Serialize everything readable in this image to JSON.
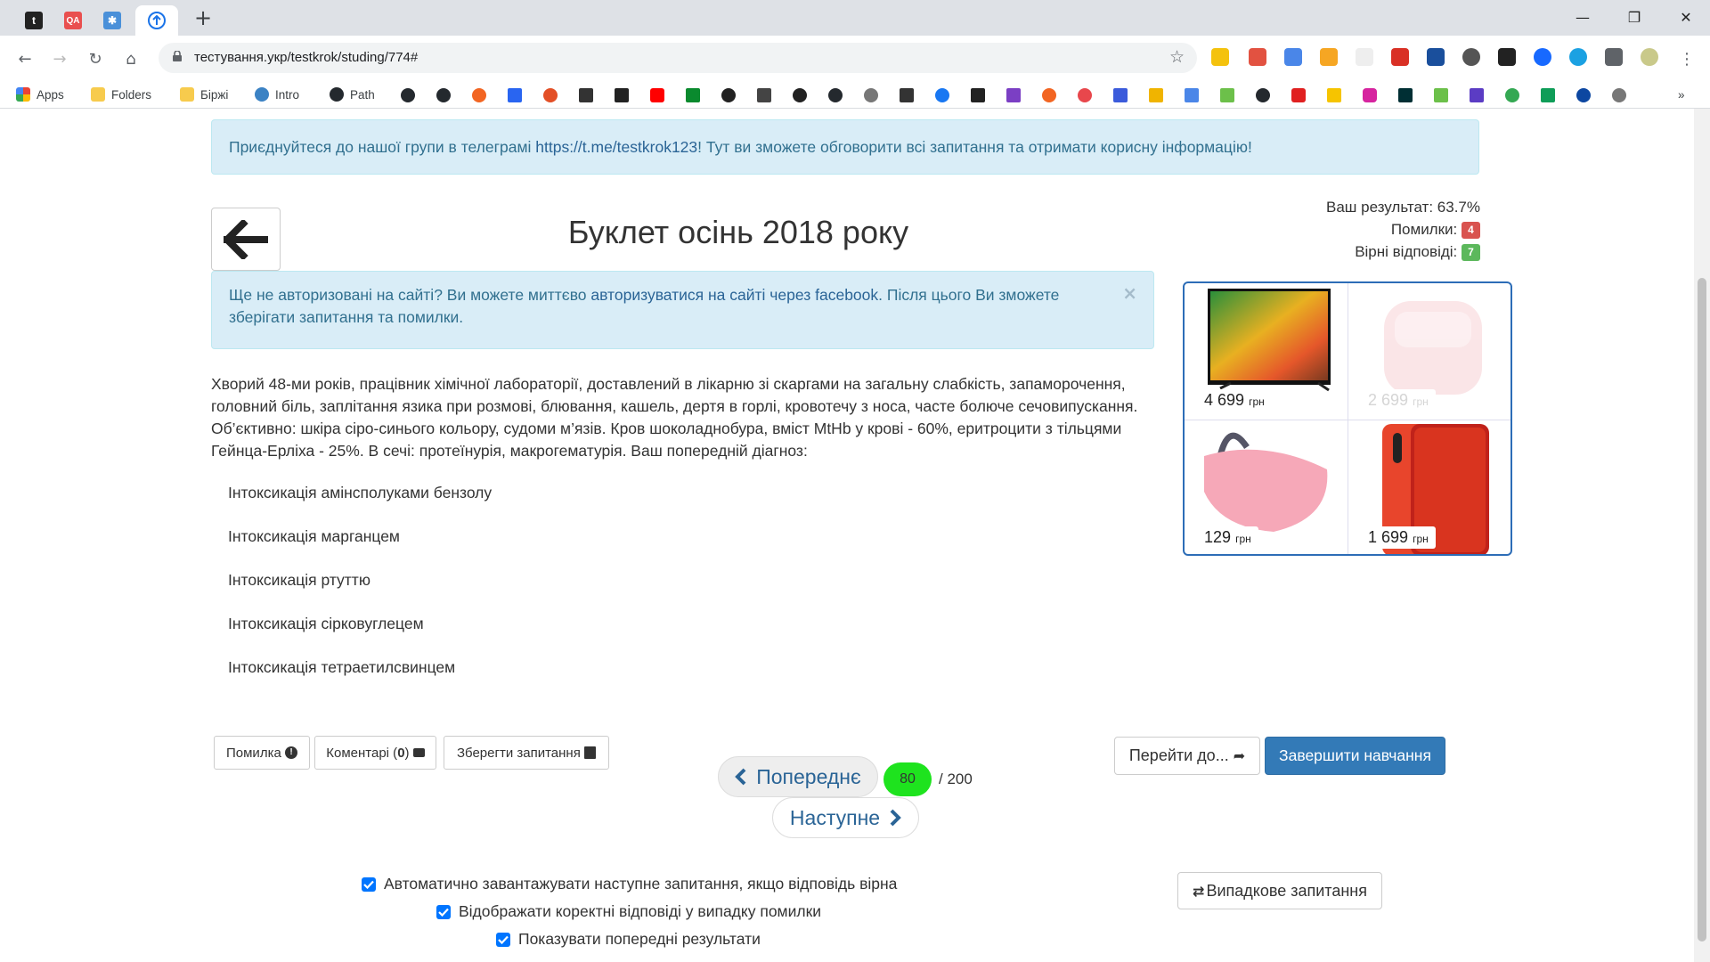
{
  "browser": {
    "url": "тестування.укр/testkrok/studing/774#",
    "tabs": [
      {
        "label": "t",
        "color": "#222222",
        "icon": "tumblr-icon"
      },
      {
        "label": "QA",
        "color": "#e94f4f",
        "icon": "qa-icon"
      },
      {
        "label": "",
        "color": "#4a90d9",
        "icon": "puzzle-icon"
      }
    ],
    "bookmarks": [
      {
        "label": "Apps",
        "color": "#4285f4"
      },
      {
        "label": "Folders",
        "color": "#f7cb4d"
      },
      {
        "label": "Біржі",
        "color": "#f7cb4d"
      },
      {
        "label": "Intro",
        "color": "#3b82c4"
      },
      {
        "label": "Path",
        "color": "#24292e"
      }
    ],
    "more_label": "»"
  },
  "telegram_alert": {
    "text_before": "Приєднуйтеся до нашої групи в телеграмі ",
    "link": "https://t.me/testkrok123",
    "text_after": "! Тут ви зможете обговорити всі запитання та отримати корисну інформацію!"
  },
  "header": {
    "title": "Буклет осінь 2018 року",
    "result_label": "Ваш результат: 63.7%",
    "errors_label": "Помилки:",
    "errors_count": "4",
    "correct_label": "Вірні відповіді:",
    "correct_count": "7",
    "colors": {
      "errors": "#d9534f",
      "correct": "#5cb85c"
    }
  },
  "auth_alert": {
    "text_before": "Ще не авторизовані на сайті? Ви можете миттєво ",
    "link": "авторизуватися на сайті через facebook",
    "text_after": ". Після цього Ви зможете зберігати запитання та помилки.",
    "close": "×"
  },
  "question": {
    "text": "Хворий 48-ми років, працівник хімічної лабораторії, доставлений в лікарню зі скаргами на загальну слабкість, запаморочення, головний біль, заплітання язика при розмові, блювання, кашель, дертя в горлі, кровотечу з носа, часте болюче сечовипускання. Об’єктивно: шкіра сіро-синього кольору, судоми м’язів. Кров шоколаднобура, вміст MtHb у крові - 60%, еритроцити з тільцями Гейнца-Ерліха - 25%. В сечі: протеїнурія, макрогематурія. Ваш попередній діагноз:",
    "answers": [
      "Інтоксикація амінсполуками бензолу",
      "Інтоксикація марганцем",
      "Інтоксикація ртуттю",
      "Інтоксикація сірковуглецем",
      "Інтоксикація тетраетилсвинцем"
    ]
  },
  "ad": {
    "items": [
      {
        "price": "4 699",
        "unit": "грн",
        "product": "tv"
      },
      {
        "price": "2 699",
        "unit": "грн",
        "product": "earbuds"
      },
      {
        "price": "129",
        "unit": "грн",
        "product": "mask"
      },
      {
        "price": "1 699",
        "unit": "грн",
        "product": "phone"
      }
    ]
  },
  "actions": {
    "error_label": "Помилка",
    "comments_label": "Коментарі (",
    "comments_count": "0",
    "comments_close": ")",
    "save_label": "Зберегти запитання",
    "prev_label": "Попереднє",
    "next_label": "Наступне",
    "current": "80",
    "total": "/ 200",
    "goto_label": "Перейти до...",
    "finish_label": "Завершити навчання",
    "random_label": "Випадкове запитання"
  },
  "options": [
    {
      "label": "Автоматично завантажувати наступне запитання, якщо відповідь вірна",
      "checked": true
    },
    {
      "label": "Відображати коректні відповіді у випадку помилки",
      "checked": true
    },
    {
      "label": "Показувати попередні результати",
      "checked": true
    }
  ]
}
